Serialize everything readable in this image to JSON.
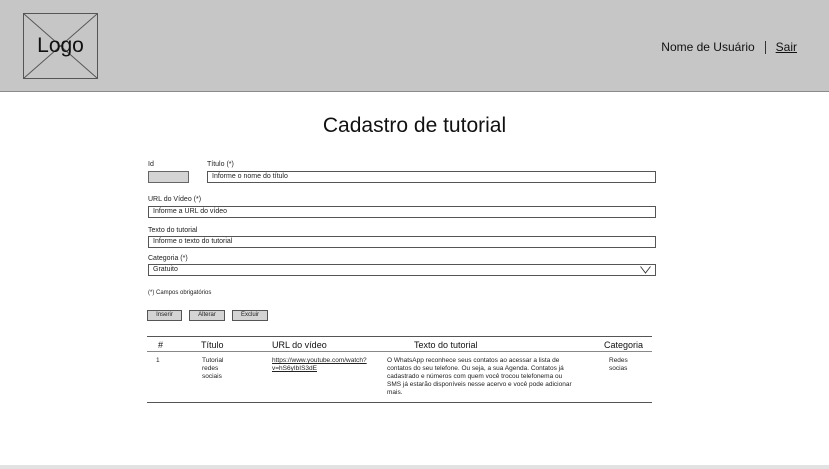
{
  "header": {
    "logo_text": "Logo",
    "user_name": "Nome de Usuário",
    "logout_label": "Sair"
  },
  "page": {
    "title": "Cadastro de tutorial"
  },
  "form": {
    "id": {
      "label": "Id",
      "value": ""
    },
    "title": {
      "label": "Título (*)",
      "value": "Informe o nome do título"
    },
    "video_url": {
      "label": "URL do Vídeo (*)",
      "value": "Informe a URL do vídeo"
    },
    "tutorial_text": {
      "label": "Texto do tutorial",
      "value": "Informe o texto do tutorial"
    },
    "category": {
      "label": "Categoria (*)",
      "value": "Gratuito"
    },
    "required_note": "(*) Campos obrigatórios"
  },
  "buttons": {
    "insert": "Inserir",
    "update": "Alterar",
    "delete": "Excluir"
  },
  "table": {
    "headers": [
      "#",
      "Título",
      "URL do vídeo",
      "Texto do tutorial",
      "Categoria"
    ],
    "rows": [
      {
        "id": "1",
        "title": "Tutorial redes sociais",
        "url": "https://www.youtube.com/watch?v=hS6yIbIS3dE",
        "text": "O WhatsApp reconhece seus contatos ao acessar a lista de contatos do seu telefone. Ou seja, a sua Agenda. Contatos já cadastrado e números com quem você trocou telefonema ou SMS já estarão disponíveis nesse acervo e você pode adicionar mais.",
        "category": "Redes socias"
      }
    ]
  },
  "icons": {
    "select_arrow": "chevron-down-icon"
  }
}
